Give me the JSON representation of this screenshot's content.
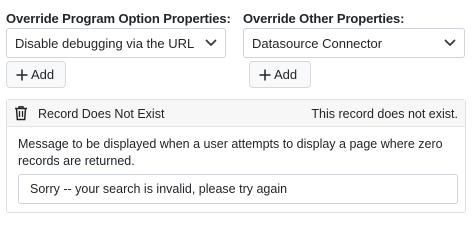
{
  "program_options": {
    "label": "Override Program Option Properties:",
    "selected": "Disable debugging via the URL",
    "add_label": "Add"
  },
  "other_properties": {
    "label": "Override Other Properties:",
    "selected": "Datasource Connector",
    "add_label": "Add"
  },
  "record_rule": {
    "name": "Record Does Not Exist",
    "message": "This record does not exist.",
    "description": "Message to be displayed when a user attempts to display a page where zero records are returned.",
    "input_value": "Sorry -- your search is invalid, please try again"
  },
  "icons": {
    "dropdown": "chevron-down-icon",
    "add": "plus-icon",
    "delete": "trash-icon"
  },
  "colors": {
    "border": "#ced4da",
    "header_bg": "#f7f7f7",
    "button_bg": "#f8f9fa",
    "text": "#212529"
  }
}
